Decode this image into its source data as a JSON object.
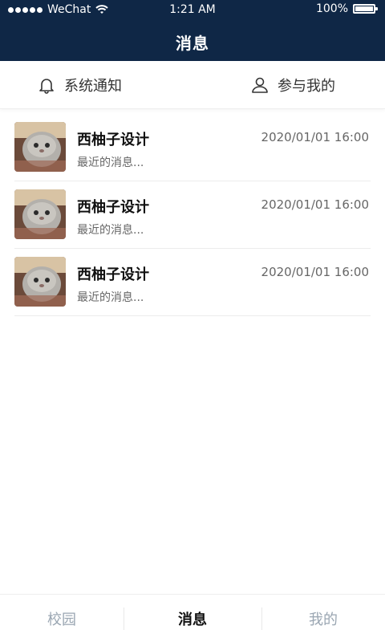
{
  "status_bar": {
    "carrier": "WeChat",
    "time": "1:21 AM",
    "battery": "100%"
  },
  "header": {
    "title": "消息"
  },
  "tabs": [
    {
      "label": "系统通知",
      "icon": "bell-icon"
    },
    {
      "label": "参与我的",
      "icon": "person-icon"
    }
  ],
  "messages": [
    {
      "name": "西柚子设计",
      "preview": "最近的消息...",
      "date": "2020/01/01 16:00"
    },
    {
      "name": "西柚子设计",
      "preview": "最近的消息...",
      "date": "2020/01/01 16:00"
    },
    {
      "name": "西柚子设计",
      "preview": "最近的消息...",
      "date": "2020/01/01 16:00"
    }
  ],
  "bottom_nav": [
    {
      "label": "校园"
    },
    {
      "label": "消息"
    },
    {
      "label": "我的"
    }
  ],
  "colors": {
    "header_bg": "#0f2746",
    "active_nav": "#111111",
    "inactive_nav": "#9aa6b2"
  }
}
